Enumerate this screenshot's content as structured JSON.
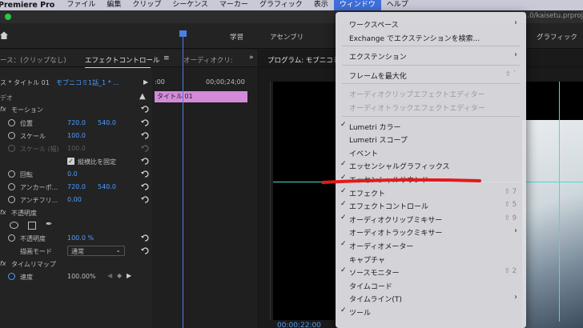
{
  "menubar": {
    "app_name": "Premiere Pro",
    "items": [
      "ファイル",
      "編集",
      "クリップ",
      "シーケンス",
      "マーカー",
      "グラフィック",
      "表示",
      "ウィンドウ",
      "ヘルプ"
    ],
    "active": "ウィンドウ"
  },
  "titlebar": {
    "project_path": "1.0/kaisetu.prproj"
  },
  "workspace": {
    "tabs": [
      "学習",
      "アセンブリ",
      "グラフィック"
    ]
  },
  "effect_controls": {
    "tabs": [
      "ース：(クリップなし)",
      "エフェクトコントロール",
      "オーディオクリ:"
    ],
    "source_label": "ス * タイトル 01",
    "sequence_label": "モブニコミ1話_1 * ...",
    "ruler_start": ":00",
    "ruler_time": "00;00;24;00",
    "video_label": "デオ",
    "clip_name": "タイトル 01",
    "motion": "モーション",
    "position": {
      "label": "位置",
      "x": "720.0",
      "y": "540.0"
    },
    "scale": {
      "label": "スケール",
      "value": "100.0"
    },
    "scale_width": {
      "label": "スケール (幅)",
      "value": "100.0"
    },
    "uniform_scale": "縦横比を固定",
    "rotation": {
      "label": "回転",
      "value": "0.0"
    },
    "anchor": {
      "label": "アンカーポ...",
      "x": "720.0",
      "y": "540.0"
    },
    "antiflicker": {
      "label": "アンチフリ...",
      "value": "0.00"
    },
    "opacity_group": "不透明度",
    "opacity": {
      "label": "不透明度",
      "value": "100.0 %"
    },
    "blend_mode": {
      "label": "描画モード",
      "value": "通常"
    },
    "time_remap": "タイムリマップ",
    "speed": {
      "label": "速度",
      "value": "100.00%"
    }
  },
  "program_monitor": {
    "title": "プログラム: モブニコミ",
    "timecode": "00:00:22:00"
  },
  "window_menu": {
    "items": [
      {
        "label": "ワークスペース",
        "submenu": true
      },
      {
        "label": "Exchange でエクステンションを検索..."
      },
      {
        "sep": true
      },
      {
        "label": "エクステンション",
        "submenu": true
      },
      {
        "sep": true
      },
      {
        "label": "フレームを最大化",
        "shortcut": "⇧ `"
      },
      {
        "sep": true
      },
      {
        "label": "オーディオクリップエフェクトエディター",
        "disabled": true
      },
      {
        "label": "オーディオトラックエフェクトエディター",
        "disabled": true
      },
      {
        "sep": true
      },
      {
        "label": "Lumetri カラー",
        "checked": true
      },
      {
        "label": "Lumetri スコープ"
      },
      {
        "label": "イベント"
      },
      {
        "label": "エッセンシャルグラフィックス",
        "checked": true
      },
      {
        "label": "エッセンシャルサウンド",
        "checked": true
      },
      {
        "label": "エフェクト",
        "checked": true,
        "shortcut": "⇧ 7"
      },
      {
        "label": "エフェクトコントロール",
        "checked": true,
        "shortcut": "⇧ 5"
      },
      {
        "label": "オーディオクリップミキサー",
        "checked": true,
        "shortcut": "⇧ 9"
      },
      {
        "label": "オーディオトラックミキサー",
        "submenu": true
      },
      {
        "label": "オーディオメーター",
        "checked": true
      },
      {
        "label": "キャプチャ"
      },
      {
        "label": "ソースモニター",
        "checked": true,
        "shortcut": "⇧ 2"
      },
      {
        "label": "タイムコード"
      },
      {
        "label": "タイムライン(T)",
        "submenu": true
      },
      {
        "label": "ツール",
        "checked": true
      }
    ]
  },
  "colors": {
    "menu_active": "#3f6fd9",
    "value_blue": "#4d9fff",
    "clip_pink": "#d38ad9",
    "annotation_red": "#e21a1a",
    "guide_cyan": "#4ad9d9"
  }
}
